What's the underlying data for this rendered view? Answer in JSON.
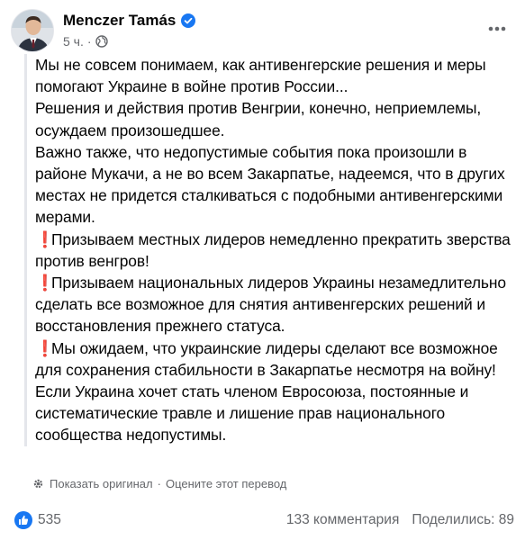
{
  "post": {
    "author": "Menczer Tamás",
    "time": "5 ч.",
    "separator": "·",
    "paragraphs": [
      "Мы не совсем понимаем, как антивенгерские решения и меры помогают Украине в войне против России...",
      "Решения и действия против Венгрии, конечно, неприемлемы, осуждаем произошедшее.",
      "Важно также, что недопустимые события пока произошли в районе Мукачи, а не во всем Закарпатье, надеемся, что в других местах не придется сталкиваться с подобными антивенгерскими мерами."
    ],
    "bullets": [
      "Призываем местных лидеров немедленно прекратить зверства против венгров!",
      "Призываем национальных лидеров Украины незамедлительно сделать все возможное для снятия антивенгерских решений и восстановления прежнего статуса.",
      "Мы ожидаем, что украинские лидеры сделают все возможное для сохранения стабильности в Закарпатье несмотря на войну!"
    ],
    "closing": "Если Украина хочет стать членом Евросоюза, постоянные и систематические травле и лишение прав национального сообщества недопустимы.",
    "bullet_emoji": "❗"
  },
  "translation": {
    "show_original": "Показать оригинал",
    "separator": "·",
    "rate": "Оцените этот перевод"
  },
  "stats": {
    "reactions_count": "535",
    "comments": "133 комментария",
    "shares": "Поделились: 89"
  },
  "icons": {
    "verified": "verified-badge-icon",
    "audience": "globe-icon",
    "more": "more-options-icon",
    "translate": "gear-icon",
    "like": "like-reaction-icon"
  },
  "colors": {
    "accent": "#1877f2",
    "secondary_text": "#65676b",
    "emoji_red": "#dd2e44"
  }
}
